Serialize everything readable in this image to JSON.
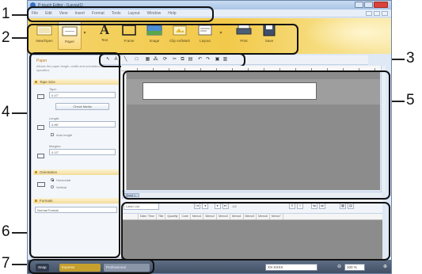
{
  "callouts": [
    "1",
    "2",
    "3",
    "4",
    "5",
    "6",
    "7"
  ],
  "window": {
    "title": "P-touch Editor - [Layout1]",
    "menus": [
      "File",
      "Edit",
      "View",
      "Insert",
      "Format",
      "Tools",
      "Layout",
      "Window",
      "Help"
    ]
  },
  "ribbon": {
    "buttons": [
      {
        "label": "New/Open",
        "icon": "new-open-icon"
      },
      {
        "label": "Paper",
        "icon": "paper-icon"
      },
      {
        "label": "Text",
        "icon": "text-icon"
      },
      {
        "label": "Frame",
        "icon": "frame-icon"
      },
      {
        "label": "Image",
        "icon": "image-icon"
      },
      {
        "label": "Clip Art/Mark",
        "icon": "clipart-icon"
      },
      {
        "label": "Layout",
        "icon": "layout-icon"
      },
      {
        "label": "Print",
        "icon": "print-icon"
      },
      {
        "label": "Save",
        "icon": "save-icon"
      }
    ],
    "text_glyph": "A"
  },
  "dock": {
    "title": "Paper",
    "description": "Allows the paper length, width and orientation to be specified.",
    "sections": [
      "Tape Size",
      "Orientation",
      "Formats"
    ],
    "tape_label": "Tape:",
    "tape_value": "0.47\"",
    "check_media": "Check Media",
    "length_label": "Length:",
    "length_value": "4.96\"",
    "auto_length": "Auto length",
    "margins_label": "Margins:",
    "margins_value": "0.12\"",
    "horizontal": "Horizontal",
    "vertical": "Vertical",
    "format_value": "Normal Format"
  },
  "editor": {
    "sheet_tab": "Sheet 1"
  },
  "database": {
    "field_value": "Label List",
    "record_value": "1/8",
    "columns": [
      "Date / Time",
      "Title",
      "Quantity",
      "Code",
      "Memo1",
      "Memo2",
      "Memo3",
      "Memo4",
      "Memo5",
      "Memo6",
      "Memo7"
    ]
  },
  "statusbar": {
    "tabs": [
      "Snap",
      "Express",
      "Professional"
    ],
    "printer": "XX-XXXX",
    "zoom": "100 %"
  }
}
